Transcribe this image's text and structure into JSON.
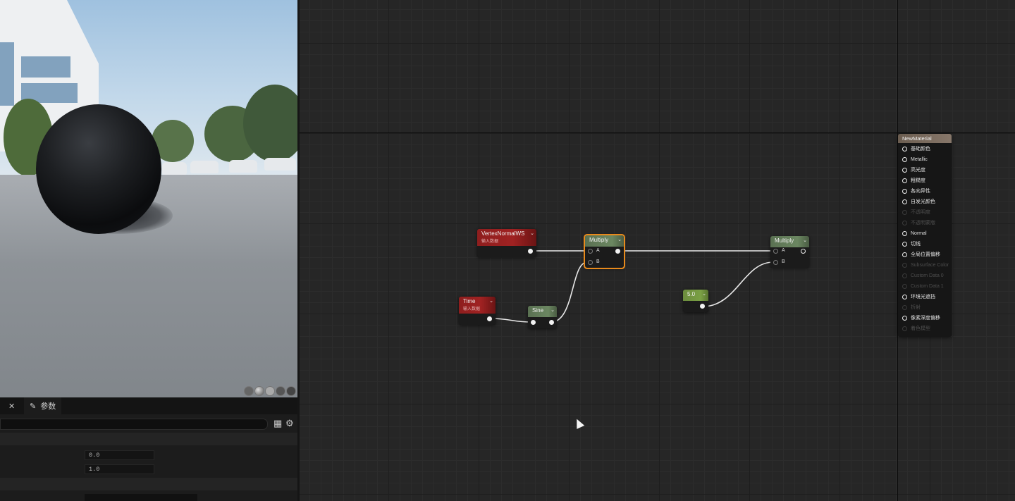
{
  "details": {
    "tab_label": "参数",
    "search_placeholder": "",
    "field1_value": "0.0",
    "field2_value": "1.0"
  },
  "nodes": {
    "vertex": {
      "title": "VertexNormalWS",
      "subtitle": "输入数据"
    },
    "multiply1": {
      "title": "Multiply",
      "pin_a": "A",
      "pin_b": "B"
    },
    "time": {
      "title": "Time",
      "subtitle": "输入数据"
    },
    "sine": {
      "title": "Sine"
    },
    "constant": {
      "title": "5.0"
    },
    "multiply2": {
      "title": "Multiply",
      "pin_a": "A",
      "pin_b": "B"
    }
  },
  "result_node": {
    "title": "NewMaterial",
    "pins": [
      {
        "label": "基础颜色",
        "enabled": true
      },
      {
        "label": "Metallic",
        "enabled": true
      },
      {
        "label": "高光度",
        "enabled": true
      },
      {
        "label": "粗糙度",
        "enabled": true
      },
      {
        "label": "各向异性",
        "enabled": true
      },
      {
        "label": "自发光颜色",
        "enabled": true
      },
      {
        "label": "不透明度",
        "enabled": false
      },
      {
        "label": "不透明蒙版",
        "enabled": false
      },
      {
        "label": "Normal",
        "enabled": true
      },
      {
        "label": "切线",
        "enabled": true
      },
      {
        "label": "全局位置偏移",
        "enabled": true
      },
      {
        "label": "Subsurface Color",
        "enabled": false
      },
      {
        "label": "Custom Data 0",
        "enabled": false
      },
      {
        "label": "Custom Data 1",
        "enabled": false
      },
      {
        "label": "环境光遮挡",
        "enabled": true
      },
      {
        "label": "折射",
        "enabled": false
      },
      {
        "label": "像素深度偏移",
        "enabled": true
      },
      {
        "label": "着色模型",
        "enabled": false
      }
    ]
  },
  "colors": {
    "accent_selection": "#e88a1c",
    "node_red": "#a02222",
    "node_green": "#6b8761",
    "graph_bg": "#262626"
  },
  "icons": [
    "close-icon",
    "pencil-icon",
    "grid-icon",
    "gear-icon",
    "mouse-cursor-icon"
  ]
}
